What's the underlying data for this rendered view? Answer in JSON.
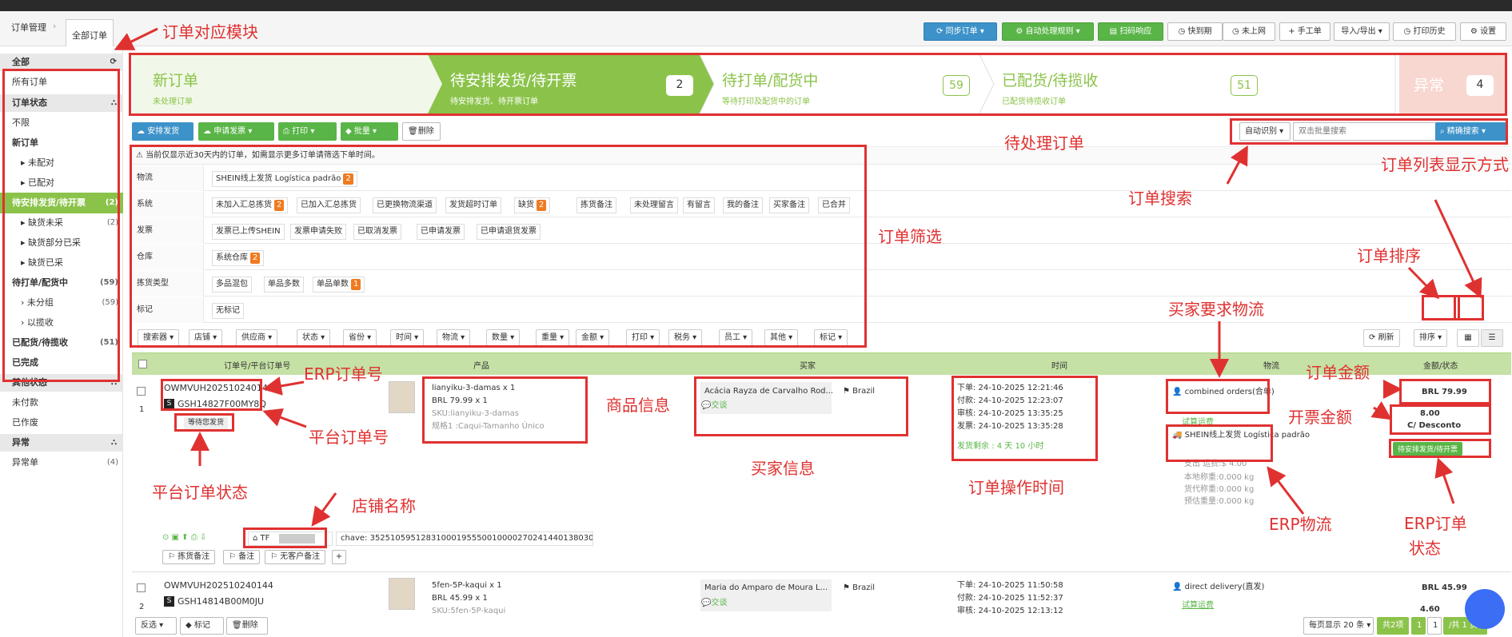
{
  "breadcrumb": {
    "root": "订单管理",
    "sep": "›",
    "active_tab": "全部订单"
  },
  "toolbar": {
    "sync": "同步订单",
    "auto_rule": "自动处理规则",
    "scan": "扫码响应",
    "expiring": "快到期",
    "not_online": "未上网",
    "manual": "手工单",
    "import_export": "导入/导出",
    "print_history": "打印历史",
    "settings": "设置"
  },
  "sidebar": {
    "all": "全部",
    "all_orders": "所有订单",
    "order_status": "订单状态",
    "unlimited": "不限",
    "new_order": "新订单",
    "unpaired": "未配对",
    "paired": "已配对",
    "pending_ship": "待安排发货/待开票",
    "pending_ship_cnt": "(2)",
    "out_of_stock": "缺货未采",
    "out_of_stock_cnt": "(2)",
    "partial_purchase": "缺货部分已采",
    "purchased": "缺货已采",
    "to_print": "待打单/配货中",
    "to_print_cnt": "(59)",
    "ungrouped": "未分组",
    "ungrouped_cnt": "(59)",
    "collected": "以揽收",
    "shipped": "已配货/待揽收",
    "shipped_cnt": "(51)",
    "completed": "已完成",
    "other_status": "其他状态",
    "unpaid": "未付款",
    "voided": "已作废",
    "abnormal": "异常",
    "abnormal_orders": "异常单",
    "abnormal_cnt": "(4)"
  },
  "steps": [
    {
      "title": "新订单",
      "sub": "未处理订单",
      "count": ""
    },
    {
      "title": "待安排发货/待开票",
      "sub": "待安排发货、待开票订单",
      "count": "2"
    },
    {
      "title": "待打单/配货中",
      "sub": "等待打印及配货中的订单",
      "count": "59"
    },
    {
      "title": "已配货/待揽收",
      "sub": "已配货待揽收订单",
      "count": "51"
    },
    {
      "title": "异常",
      "sub": "",
      "count": "4"
    }
  ],
  "actions": {
    "arrange": "安排发货",
    "invoice": "申请发票",
    "print": "打印",
    "batch": "批量",
    "delete": "删除",
    "auto_detect": "自动识别",
    "search_placeholder": "双击批量搜索",
    "fuzzy_search": "精确搜索"
  },
  "filter": {
    "notice": "当前仅显示近30天内的订单，如需显示更多订单请筛选下单时间。",
    "rows": [
      {
        "label": "物流",
        "tags": [
          {
            "t": "SHEIN线上发货 Logística padrão",
            "c": "2"
          }
        ]
      },
      {
        "label": "系统",
        "tags": [
          {
            "t": "未加入汇总拣货",
            "c": "2"
          },
          {
            "t": "已加入汇总拣货",
            "c": ""
          },
          {
            "t": "已更换物流渠道",
            "c": ""
          },
          {
            "t": "发货超时订单",
            "c": ""
          },
          {
            "t": "缺货",
            "c": "2"
          },
          {
            "t": "拣货备注",
            "c": ""
          },
          {
            "t": "未处理留言",
            "c": ""
          },
          {
            "t": "有留言",
            "c": ""
          },
          {
            "t": "我的备注",
            "c": ""
          },
          {
            "t": "买家备注",
            "c": ""
          },
          {
            "t": "已合并",
            "c": ""
          }
        ]
      },
      {
        "label": "发票",
        "tags": [
          {
            "t": "发票已上传SHEIN",
            "c": ""
          },
          {
            "t": "发票申请失败",
            "c": ""
          },
          {
            "t": "已取消发票",
            "c": ""
          },
          {
            "t": "已申请发票",
            "c": ""
          },
          {
            "t": "已申请退货发票",
            "c": ""
          }
        ]
      },
      {
        "label": "仓库",
        "tags": [
          {
            "t": "系统仓库",
            "c": "2"
          }
        ]
      },
      {
        "label": "拣货类型",
        "tags": [
          {
            "t": "多品混包",
            "c": ""
          },
          {
            "t": "单品多数",
            "c": ""
          },
          {
            "t": "单品单数",
            "c": "1"
          }
        ]
      },
      {
        "label": "标记",
        "tags": [
          {
            "t": "无标记",
            "c": ""
          }
        ]
      }
    ],
    "dropdowns": [
      "搜索器",
      "店铺",
      "供应商",
      "状态",
      "省份",
      "时间",
      "物流",
      "数量",
      "重量",
      "金额",
      "打印",
      "税务",
      "员工",
      "其他",
      "标记"
    ],
    "refresh": "刷新",
    "sort": "排序"
  },
  "table": {
    "headers": [
      "订单号/平台订单号",
      "产品",
      "买家",
      "时间",
      "物流",
      "金额/状态"
    ],
    "orders": [
      {
        "index": "1",
        "order_no": "OWMVUH202510240149",
        "platform_no": "GSH14827F00MY8Q",
        "platform_status": "等待您发货",
        "product": "lianyiku-3-damas x 1",
        "price": "BRL 79.99 x 1",
        "sku": "SKU:lianyiku-3-damas",
        "spec": "规格1 :Caqui-Tamanho Único",
        "buyer": "Acácia Rayza de Carvalho Rod...",
        "country": "Brazil",
        "buyer_tag": "交谈",
        "placed": "下单:  24-10-2025 12:21:46",
        "paid": "付款:  24-10-2025 12:23:07",
        "audit": "审核:  24-10-2025 13:35:25",
        "ship": "发票:  24-10-2025 13:35:28",
        "remain": "发货剩余 :  4 天 10 小时",
        "buyer_logistics": "combined orders(合单)",
        "trial": "试算运费",
        "erp_logistics": "SHEIN线上发货 Logística padrão",
        "cost": "支出  运费:$ 4.00",
        "weight1": "本地称重:0.000 kg",
        "weight2": "货代称重:0.000 kg",
        "weight3": "预估重量:0.000 kg",
        "amount": "BRL 79.99",
        "invoice": "8.00",
        "invoice_note": "C/ Desconto",
        "erp_status": "待安排发货/待开票",
        "shop": "TF",
        "chave": "chave: 35251059512831000195550010000270241440138030",
        "note1": "拣货备注",
        "note2": "备注",
        "note3": "无客户备注"
      },
      {
        "index": "2",
        "order_no": "OWMVUH202510240144",
        "platform_no": "GSH14814B00M0JU",
        "platform_status": "",
        "product": "5fen-5P-kaqui x 1",
        "price": "BRL 45.99 x 1",
        "sku": "SKU:5fen-5P-kaqui",
        "spec": "",
        "buyer": "Maria do Amparo de Moura L...",
        "country": "Brazil",
        "buyer_tag": "交谈",
        "placed": "下单:  24-10-2025 11:50:58",
        "paid": "付款:  24-10-2025 11:52:37",
        "audit": "审核:  24-10-2025 12:13:12",
        "ship": "",
        "remain": "",
        "buyer_logistics": "direct delivery(直发)",
        "trial": "试算运费",
        "erp_logistics": "",
        "cost": "",
        "weight1": "",
        "weight2": "",
        "weight3": "",
        "amount": "BRL 45.99",
        "invoice": "4.60",
        "invoice_note": "",
        "erp_status": "",
        "shop": "",
        "chave": "",
        "note1": "",
        "note2": "",
        "note3": ""
      }
    ]
  },
  "bottom": {
    "reverse": "反选",
    "mark": "标记",
    "delete": "删除",
    "page_size": "每页显示 20 条",
    "total": "共2项",
    "page": "1",
    "page_of": "1",
    "total_pages": "/共 1 页"
  },
  "annotations": {
    "module": "订单对应模块",
    "pending": "待处理订单",
    "search": "订单搜索",
    "display_mode": "订单列表显示方式",
    "display_mode2": "示方式",
    "filter": "订单筛选",
    "sort": "订单排序",
    "buyer_logistics": "买家要求物流",
    "erp_no": "ERP订单号",
    "amount": "订单金额",
    "product_info": "商品信息",
    "invoice_amount": "开票金额",
    "platform_no": "平台订单号",
    "buyer_info": "买家信息",
    "platform_status": "平台订单状态",
    "shop_name": "店铺名称",
    "op_time": "订单操作时间",
    "erp_logistics": "ERP物流",
    "erp_status": "ERP订单",
    "erp_status2": "状态"
  },
  "colors": {
    "accent_green": "#8bc34a",
    "annotation_red": "#e03131",
    "blue": "#3d92c9"
  }
}
